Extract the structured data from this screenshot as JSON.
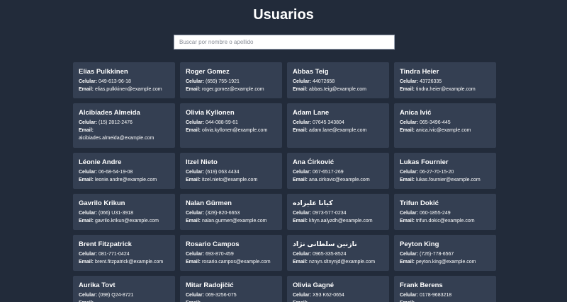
{
  "page": {
    "title": "Usuarios",
    "search_placeholder": "Buscar por nombre o apellido"
  },
  "labels": {
    "phone": "Celular:",
    "email": "Email:"
  },
  "users": [
    {
      "name": "Elias Pulkkinen",
      "phone": "049-613-96-18",
      "email": "elias.pulkkinen@example.com"
    },
    {
      "name": "Roger Gomez",
      "phone": "(659) 755-1921",
      "email": "roger.gomez@example.com"
    },
    {
      "name": "Abbas Teig",
      "phone": "44072658",
      "email": "abbas.teig@example.com"
    },
    {
      "name": "Tindra Heier",
      "phone": "43726335",
      "email": "tindra.heier@example.com"
    },
    {
      "name": "Alcibíades Almeida",
      "phone": "(15) 2812-2476",
      "email": "alcibiades.almeida@example.com"
    },
    {
      "name": "Olivia Kyllonen",
      "phone": "044-088-59-61",
      "email": "olivia.kyllonen@example.com"
    },
    {
      "name": "Adam Lane",
      "phone": "07645 343804",
      "email": "adam.lane@example.com"
    },
    {
      "name": "Anica Ivić",
      "phone": "065-3496-445",
      "email": "anica.ivic@example.com"
    },
    {
      "name": "Léonie Andre",
      "phone": "06-68-54-19-08",
      "email": "leonie.andre@example.com"
    },
    {
      "name": "Itzel Nieto",
      "phone": "(619) 063 4434",
      "email": "itzel.nieto@example.com"
    },
    {
      "name": "Ana Ćirković",
      "phone": "067-6517-269",
      "email": "ana.cirkovic@example.com"
    },
    {
      "name": "Lukas Fournier",
      "phone": "06-27-70-15-20",
      "email": "lukas.fournier@example.com"
    },
    {
      "name": "Gavrilo Krikun",
      "phone": "(066) U31-3918",
      "email": "gavrilo.krikun@example.com"
    },
    {
      "name": "Nalan Gürmen",
      "phone": "(328)-820-6653",
      "email": "nalan.gurmen@example.com"
    },
    {
      "name": "کیانا علیزاده",
      "phone": "0973-577-0234",
      "email": "khyn.aalyzdh@example.com"
    },
    {
      "name": "Trifun Dokić",
      "phone": "060-1855-249",
      "email": "trifun.dokic@example.com"
    },
    {
      "name": "Brent Fitzpatrick",
      "phone": "081-771-0424",
      "email": "brent.fitzpatrick@example.com"
    },
    {
      "name": "Rosario Campos",
      "phone": "693-870-459",
      "email": "rosario.campos@example.com"
    },
    {
      "name": "نازنین سلطانی نژاد",
      "phone": "0965-335-8524",
      "email": "nznyn.sltnynjd@example.com"
    },
    {
      "name": "Peyton King",
      "phone": "(726)-778-6567",
      "email": "peyton.king@example.com"
    },
    {
      "name": "Aurika Tovt",
      "phone": "(098) Q24-8721",
      "email": ""
    },
    {
      "name": "Mitar Radojičić",
      "phone": "069-3256-075",
      "email": ""
    },
    {
      "name": "Olivia Gagné",
      "phone": "X93 K62-0654",
      "email": ""
    },
    {
      "name": "Frank Berens",
      "phone": "0178-9683218",
      "email": ""
    }
  ]
}
